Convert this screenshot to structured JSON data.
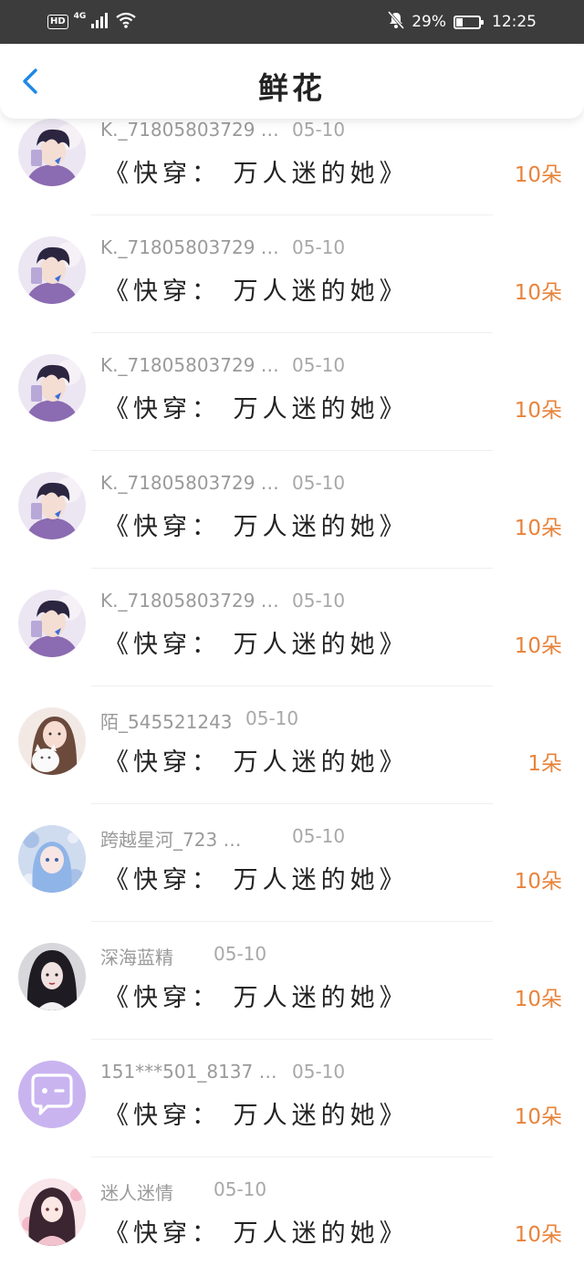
{
  "status_bar": {
    "hd": "HD",
    "network": "4G",
    "battery_percent": "29%",
    "battery_level": 0.29,
    "time": "12:25",
    "icons": [
      "signal-icon",
      "wifi-icon",
      "bell-muted-icon",
      "battery-icon"
    ]
  },
  "header": {
    "title": "鲜花",
    "back_icon": "chevron-left-icon"
  },
  "colors": {
    "accent_blue": "#1e88e5",
    "amount_orange": "#e8833a",
    "status_bar_bg": "#3c3c3c"
  },
  "rows": [
    {
      "user": "K._71805803729 …",
      "date": "05-10",
      "book": "《快穿： 万人迷的她》",
      "amount": "10朵",
      "avatar": "anime-boy"
    },
    {
      "user": "K._71805803729 …",
      "date": "05-10",
      "book": "《快穿： 万人迷的她》",
      "amount": "10朵",
      "avatar": "anime-boy"
    },
    {
      "user": "K._71805803729 …",
      "date": "05-10",
      "book": "《快穿： 万人迷的她》",
      "amount": "10朵",
      "avatar": "anime-boy"
    },
    {
      "user": "K._71805803729 …",
      "date": "05-10",
      "book": "《快穿： 万人迷的她》",
      "amount": "10朵",
      "avatar": "anime-boy"
    },
    {
      "user": "K._71805803729 …",
      "date": "05-10",
      "book": "《快穿： 万人迷的她》",
      "amount": "10朵",
      "avatar": "anime-boy"
    },
    {
      "user": "陌_545521243",
      "date": "05-10",
      "book": "《快穿： 万人迷的她》",
      "amount": "1朵",
      "avatar": "girl-cat"
    },
    {
      "user": "跨越星河_723 …",
      "date": "05-10",
      "book": "《快穿： 万人迷的她》",
      "amount": "10朵",
      "avatar": "blue-anime-girl"
    },
    {
      "user": "深海蓝精",
      "date": "05-10",
      "book": "《快穿： 万人迷的她》",
      "amount": "10朵",
      "avatar": "dark-girl"
    },
    {
      "user": "151***501_8137 …",
      "date": "05-10",
      "book": "《快穿： 万人迷的她》",
      "amount": "10朵",
      "avatar": "default-chat"
    },
    {
      "user": "迷人迷情",
      "date": "05-10",
      "book": "《快穿： 万人迷的她》",
      "amount": "10朵",
      "avatar": "pink-anime-girl"
    }
  ]
}
